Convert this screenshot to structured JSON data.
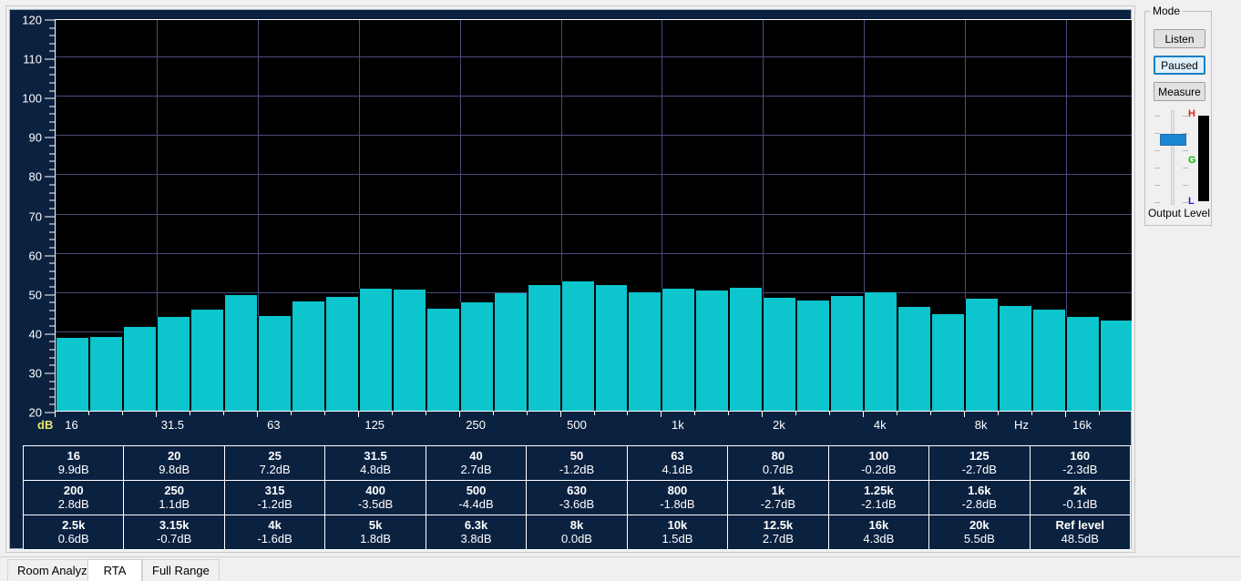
{
  "window": {
    "title": "RTA"
  },
  "axes": {
    "y_unit": "dB",
    "x_unit": "Hz",
    "y_labels": [
      "120",
      "110",
      "100",
      "90",
      "80",
      "70",
      "60",
      "50",
      "40",
      "30",
      "20"
    ],
    "x_labels": [
      "16",
      "31.5",
      "63",
      "125",
      "250",
      "500",
      "1k",
      "2k",
      "4k",
      "8k",
      "16k"
    ]
  },
  "chart_data": {
    "type": "bar",
    "title": "RTA",
    "xlabel": "Hz",
    "ylabel": "dB",
    "ylim": [
      20,
      120
    ],
    "grid": true,
    "legend": "none",
    "xscale": "log (1/3 octave bands)",
    "ytick_labels": [
      "20",
      "30",
      "40",
      "50",
      "60",
      "70",
      "80",
      "90",
      "100",
      "110",
      "120"
    ],
    "xtick_labels": [
      "16",
      "31.5",
      "63",
      "125",
      "250",
      "500",
      "1k",
      "2k",
      "4k",
      "8k",
      "16k"
    ],
    "categories": [
      "16",
      "20",
      "25",
      "31.5",
      "40",
      "50",
      "63",
      "80",
      "100",
      "125",
      "160",
      "200",
      "250",
      "315",
      "400",
      "500",
      "630",
      "800",
      "1k",
      "1.25k",
      "1.6k",
      "2k",
      "2.5k",
      "3.15k",
      "4k",
      "5k",
      "6.3k",
      "8k",
      "10k",
      "12.5k",
      "16k",
      "20k"
    ],
    "values": [
      38.6,
      38.9,
      41.4,
      43.9,
      45.7,
      49.5,
      44.2,
      47.9,
      49.1,
      51.1,
      50.8,
      45.9,
      47.6,
      49.9,
      52.0,
      52.9,
      52.1,
      50.2,
      51.0,
      50.7,
      51.3,
      48.7,
      48.1,
      49.2,
      50.2,
      46.5,
      44.7,
      48.6,
      46.8,
      45.7,
      44.0,
      43.0
    ]
  },
  "readout": {
    "rows": [
      [
        {
          "freq": "16",
          "value": "9.9dB"
        },
        {
          "freq": "20",
          "value": "9.8dB"
        },
        {
          "freq": "25",
          "value": "7.2dB"
        },
        {
          "freq": "31.5",
          "value": "4.8dB"
        },
        {
          "freq": "40",
          "value": "2.7dB"
        },
        {
          "freq": "50",
          "value": "-1.2dB"
        },
        {
          "freq": "63",
          "value": "4.1dB"
        },
        {
          "freq": "80",
          "value": "0.7dB"
        },
        {
          "freq": "100",
          "value": "-0.2dB"
        },
        {
          "freq": "125",
          "value": "-2.7dB"
        },
        {
          "freq": "160",
          "value": "-2.3dB"
        }
      ],
      [
        {
          "freq": "200",
          "value": "2.8dB"
        },
        {
          "freq": "250",
          "value": "1.1dB"
        },
        {
          "freq": "315",
          "value": "-1.2dB"
        },
        {
          "freq": "400",
          "value": "-3.5dB"
        },
        {
          "freq": "500",
          "value": "-4.4dB"
        },
        {
          "freq": "630",
          "value": "-3.6dB"
        },
        {
          "freq": "800",
          "value": "-1.8dB"
        },
        {
          "freq": "1k",
          "value": "-2.7dB"
        },
        {
          "freq": "1.25k",
          "value": "-2.1dB"
        },
        {
          "freq": "1.6k",
          "value": "-2.8dB"
        },
        {
          "freq": "2k",
          "value": "-0.1dB"
        }
      ],
      [
        {
          "freq": "2.5k",
          "value": "0.6dB"
        },
        {
          "freq": "3.15k",
          "value": "-0.7dB"
        },
        {
          "freq": "4k",
          "value": "-1.6dB"
        },
        {
          "freq": "5k",
          "value": "1.8dB"
        },
        {
          "freq": "6.3k",
          "value": "3.8dB"
        },
        {
          "freq": "8k",
          "value": "0.0dB"
        },
        {
          "freq": "10k",
          "value": "1.5dB"
        },
        {
          "freq": "12.5k",
          "value": "2.7dB"
        },
        {
          "freq": "16k",
          "value": "4.3dB"
        },
        {
          "freq": "20k",
          "value": "5.5dB"
        },
        {
          "freq": "Ref level",
          "value": "48.5dB"
        }
      ]
    ]
  },
  "mode_panel": {
    "legend": "Mode",
    "buttons": [
      {
        "label": "Listen",
        "selected": false
      },
      {
        "label": "Paused",
        "selected": true
      },
      {
        "label": "Measure",
        "selected": false
      }
    ],
    "meter_marks": {
      "high": "H",
      "good": "G",
      "low": "L"
    },
    "output_level_label": "Output Level"
  },
  "tabs": [
    {
      "label": "Room Analyzer",
      "active": false
    },
    {
      "label": "RTA",
      "active": true
    },
    {
      "label": "Full Range",
      "active": false
    }
  ],
  "colors": {
    "bar": "#0cc5cd",
    "plot_background": "#000000",
    "panel_background": "#0b2140",
    "grid": "#4b4b7e",
    "unit_label": "#e8e86a",
    "selected_button_border": "#1a7fc1",
    "meter_high": "#e02020",
    "meter_good": "#00c000",
    "meter_low": "#2020d0"
  }
}
